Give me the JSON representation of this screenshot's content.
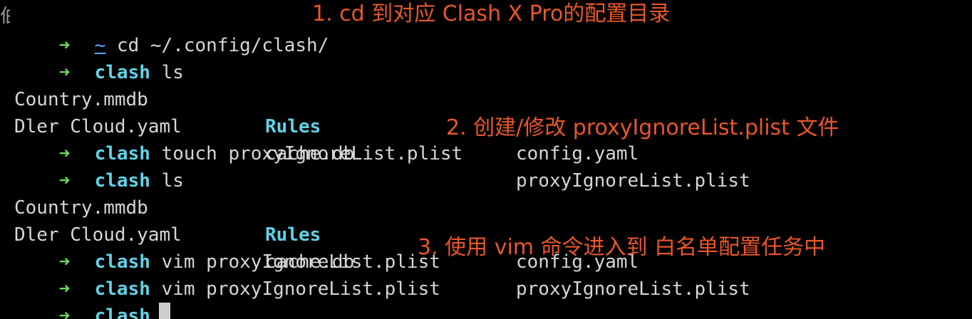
{
  "edge_char": "伯",
  "prompt_symbol": "➜",
  "lines": [
    {
      "type": "prompt",
      "dir": "~",
      "dir_home": true,
      "command": "cd ~/.config/clash/"
    },
    {
      "type": "prompt",
      "dir": "clash",
      "command": "ls"
    },
    {
      "type": "listing",
      "cols": [
        "Country.mmdb",
        "Rules",
        "config.yaml"
      ],
      "bold_col": 1
    },
    {
      "type": "listing",
      "cols": [
        "Dler Cloud.yaml",
        "cache.db",
        "proxyIgnoreList.plist"
      ]
    },
    {
      "type": "prompt",
      "dir": "clash",
      "command": "touch proxyIgnoreList.plist"
    },
    {
      "type": "prompt",
      "dir": "clash",
      "command": "ls"
    },
    {
      "type": "listing",
      "cols": [
        "Country.mmdb",
        "Rules",
        "config.yaml"
      ],
      "bold_col": 1
    },
    {
      "type": "listing",
      "cols": [
        "Dler Cloud.yaml",
        "cache.db",
        "proxyIgnoreList.plist"
      ]
    },
    {
      "type": "prompt",
      "dir": "clash",
      "command": "vim proxyIgnoreList.plist"
    },
    {
      "type": "prompt",
      "dir": "clash",
      "command": "vim proxyIgnoreList.plist"
    },
    {
      "type": "prompt",
      "dir": "clash",
      "command": "",
      "cursor": true
    }
  ],
  "annotations": [
    "1. cd 到对应 Clash X Pro的配置目录",
    "2. 创建/修改 proxyIgnoreList.plist 文件",
    "3. 使用 vim 命令进入到 白名单配置任务中"
  ],
  "colors": {
    "background": "#000000",
    "prompt_arrow": "#6ed65f",
    "directory": "#5fd3e6",
    "annotation": "#e8572a",
    "text": "#d6d6d6"
  }
}
